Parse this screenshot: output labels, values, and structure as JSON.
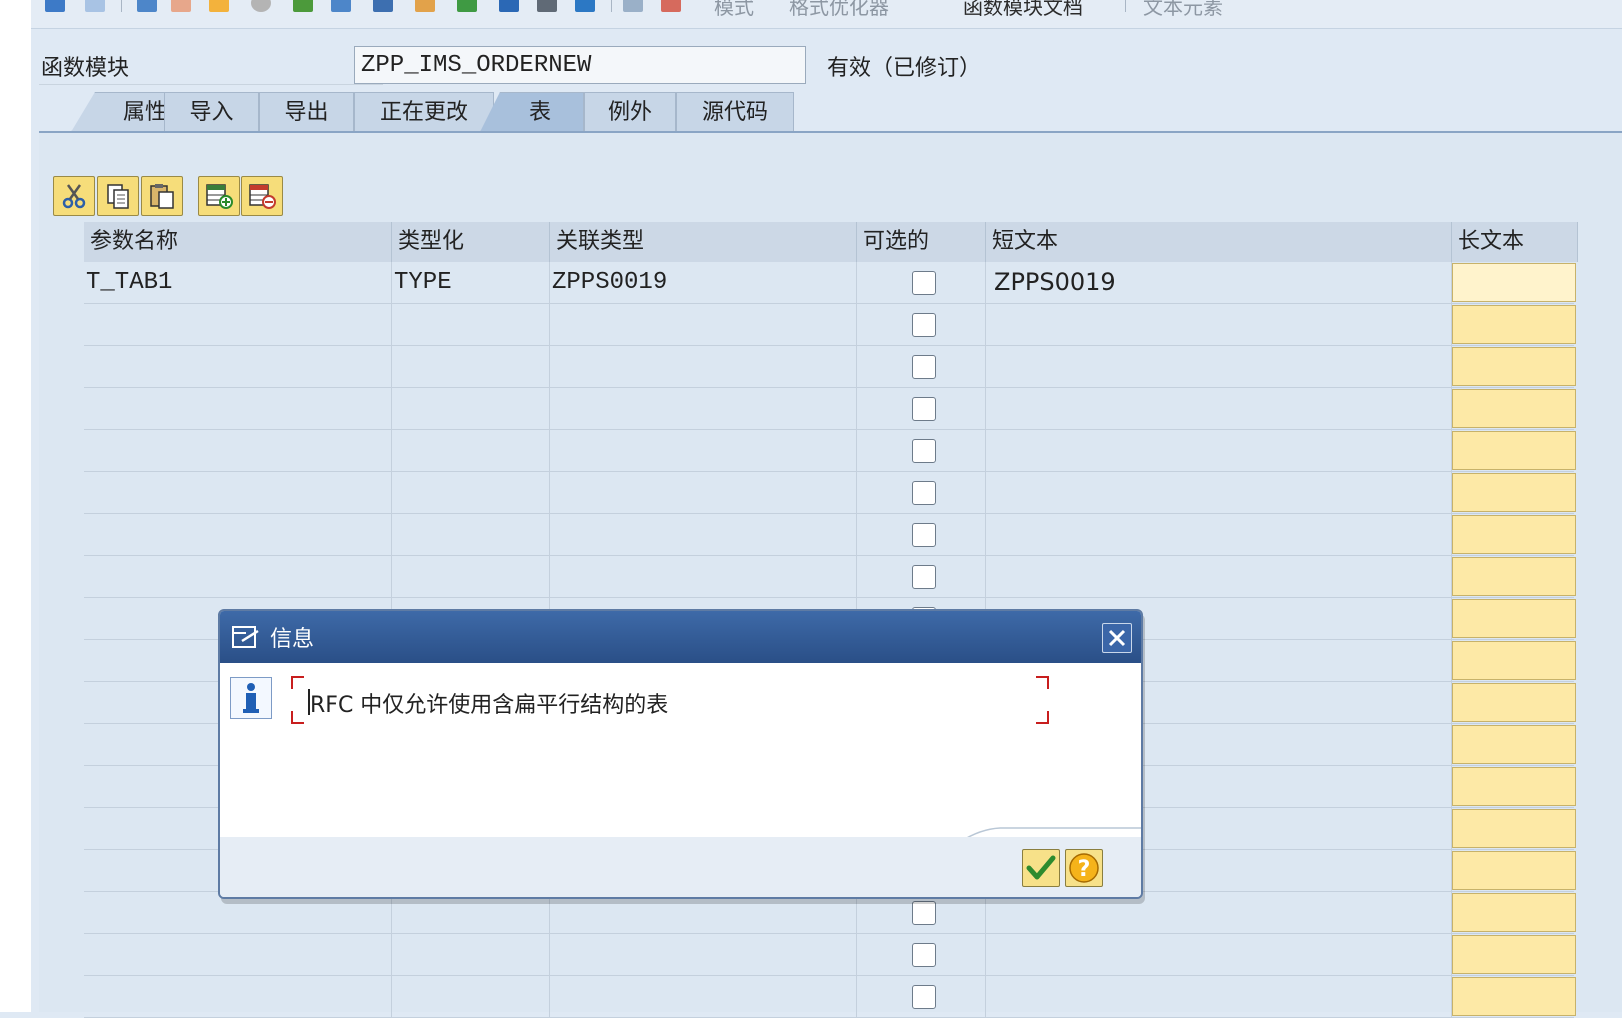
{
  "toolbar": {
    "items": [
      "模式",
      "格式优化器",
      "函数模块文档",
      "文本元素"
    ]
  },
  "header": {
    "label": "函数模块",
    "function_module": "ZPP_IMS_ORDERNEW",
    "status": "有效（已修订）"
  },
  "tabs": [
    {
      "label": "属性",
      "active": false
    },
    {
      "label": "导入",
      "active": false
    },
    {
      "label": "导出",
      "active": false
    },
    {
      "label": "正在更改",
      "active": false
    },
    {
      "label": "表",
      "active": true
    },
    {
      "label": "例外",
      "active": false
    },
    {
      "label": "源代码",
      "active": false
    }
  ],
  "table": {
    "columns": [
      "参数名称",
      "类型化",
      "关联类型",
      "可选的",
      "短文本",
      "长文本"
    ],
    "rows": [
      {
        "name": "T_TAB1",
        "typing": "TYPE",
        "ref_type": "ZPPS0019",
        "optional": false,
        "short_text": "ZPPS0019"
      }
    ]
  },
  "dialog": {
    "title": "信息",
    "message": "RFC 中仅允许使用含扁平行结构的表",
    "ok_icon": "check-icon",
    "help_icon": "help-icon"
  },
  "colors": {
    "background": "#dfe9f4",
    "dialog_title": "#2f5894",
    "long_text_cell": "#fde9a6"
  }
}
